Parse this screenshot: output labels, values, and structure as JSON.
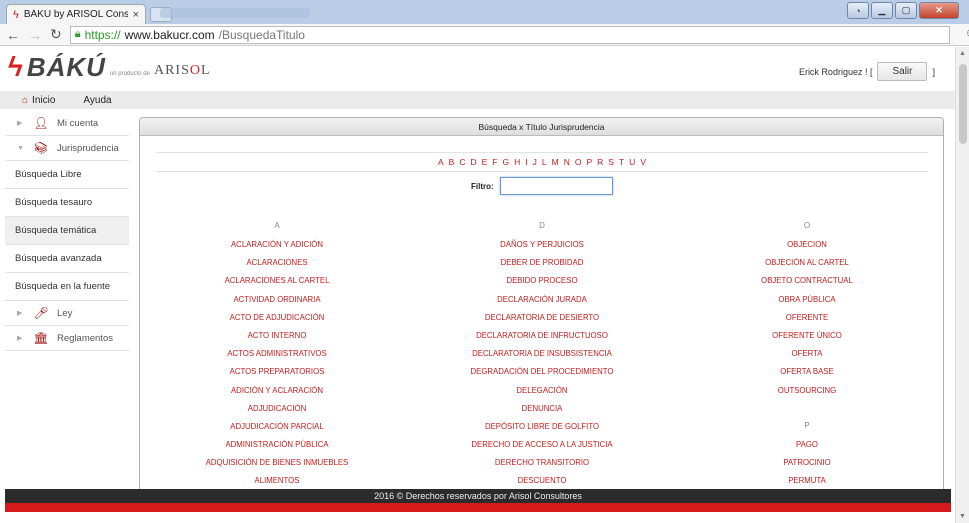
{
  "browser": {
    "tab_title": "BÁKÚ by ARISOL Consulto",
    "tab_close": "×",
    "url_scheme": "https://",
    "url_host": "www.bakucr.com",
    "url_path": "/BusquedaTitulo",
    "icons": [
      "back-icon",
      "forward-icon",
      "reload-icon",
      "lock-icon",
      "zoom-icon",
      "star-icon",
      "menu-icon"
    ]
  },
  "header": {
    "logo_text": "BÁKÚ",
    "logo_tagline": "un producto de",
    "logo_brand_1": "ARIS",
    "logo_brand_red": "O",
    "logo_brand_2": "L",
    "user_name": "Erick Rodriguez ! [",
    "logout_label": "Salir",
    "user_close": "]"
  },
  "menu": {
    "home_label": "Inicio",
    "help_label": "Ayuda"
  },
  "sidebar": {
    "items": [
      {
        "label": "Mi cuenta",
        "type": "group"
      },
      {
        "label": "Jurisprudencia",
        "type": "group"
      },
      {
        "label": "Búsqueda Libre",
        "type": "link"
      },
      {
        "label": "Búsqueda tesauro",
        "type": "link"
      },
      {
        "label": "Búsqueda temática",
        "type": "link"
      },
      {
        "label": "Búsqueda avanzada",
        "type": "link"
      },
      {
        "label": "Búsqueda en la fuente",
        "type": "link"
      },
      {
        "label": "Ley",
        "type": "group"
      },
      {
        "label": "Reglamentos",
        "type": "group"
      }
    ]
  },
  "panel": {
    "title": "Búsqueda x Título Jurisprudencia",
    "letters": [
      "A",
      "B",
      "C",
      "D",
      "E",
      "F",
      "G",
      "H",
      "I",
      "J",
      "L",
      "M",
      "N",
      "O",
      "P",
      "R",
      "S",
      "T",
      "U",
      "V"
    ],
    "filter_label": "Filtro:",
    "filter_value": "",
    "columns": [
      {
        "groups": [
          {
            "letter": "A",
            "terms": [
              "ACLARACIÓN Y ADICIÓN",
              "ACLARACIONES",
              "ACLARACIONES AL CARTEL",
              "ACTIVIDAD ORDINARIA",
              "ACTO DE ADJUDICACIÓN",
              "ACTO INTERNO",
              "ACTOS ADMINISTRATIVOS",
              "ACTOS PREPARATORIOS",
              "ADICIÓN Y ACLARACIÓN",
              "ADJUDICACIÓN",
              "ADJUDICACIÓN PARCIAL",
              "ADMINISTRACIÓN PÚBLICA",
              "ADQUISICIÓN DE BIENES INMUEBLES",
              "ALIMENTOS"
            ]
          }
        ]
      },
      {
        "groups": [
          {
            "letter": "D",
            "terms": [
              "DAÑOS Y PERJUICIOS",
              "DEBER DE PROBIDAD",
              "DEBIDO PROCESO",
              "DECLARACIÓN JURADA",
              "DECLARATORIA DE DESIERTO",
              "DECLARATORIA DE INFRUCTUOSO",
              "DECLARATORIA DE INSUBSISTENCIA",
              "DEGRADACIÓN DEL PROCEDIMIENTO",
              "DELEGACIÓN",
              "DENUNCIA",
              "DEPÓSITO LIBRE DE GOLFITO",
              "DERECHO DE ACCESO A LA JUSTICIA",
              "DERECHO TRANSITORIO",
              "DESCUENTO"
            ]
          }
        ]
      },
      {
        "groups": [
          {
            "letter": "O",
            "terms": [
              "OBJECION",
              "OBJECIÓN AL CARTEL",
              "OBJETO CONTRACTUAL",
              "OBRA PÚBLICA",
              "OFERENTE",
              "OFERENTE ÚNICO",
              "OFERTA",
              "OFERTA BASE",
              "OUTSOURCING"
            ]
          },
          {
            "letter": "P",
            "terms": [
              "PAGO",
              "PATROCINIO",
              "PERMUTA"
            ]
          }
        ]
      }
    ]
  },
  "footer": {
    "text": "2016 © Derechos reservados por Arisol Consultores"
  },
  "colors": {
    "brand_red": "#c41c1c",
    "footer_dark": "#2b2b2b",
    "footer_red": "#d41a1a"
  }
}
